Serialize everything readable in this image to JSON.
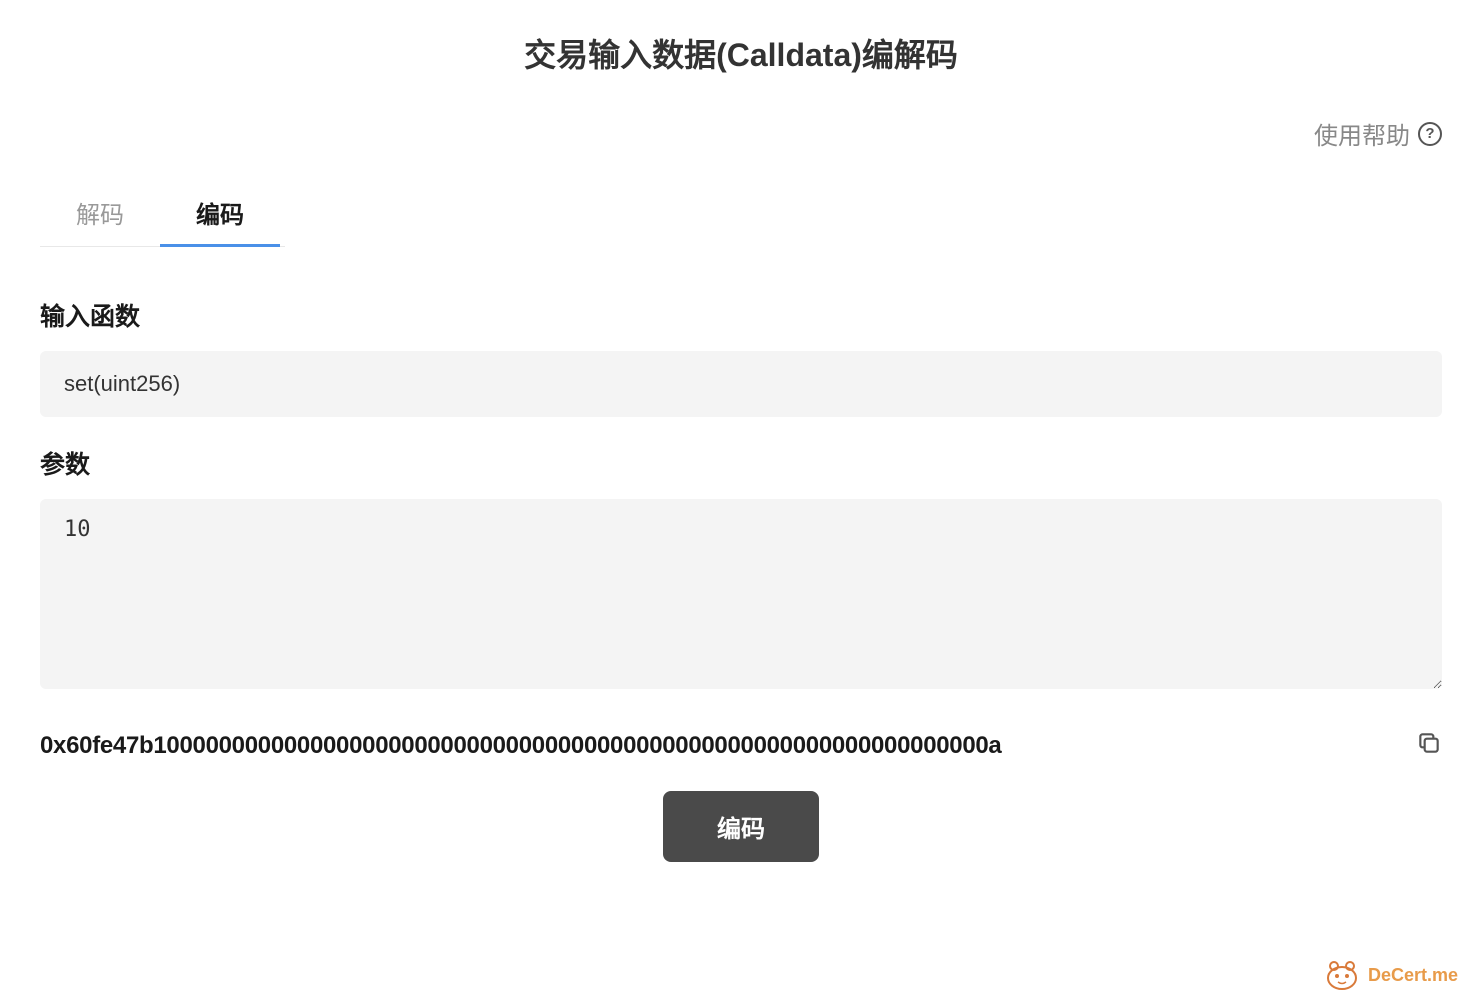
{
  "page_title": "交易输入数据(Calldata)编解码",
  "help": {
    "label": "使用帮助"
  },
  "tabs": [
    {
      "label": "解码",
      "active": false
    },
    {
      "label": "编码",
      "active": true
    }
  ],
  "fields": {
    "function": {
      "label": "输入函数",
      "value": "set(uint256)"
    },
    "params": {
      "label": "参数",
      "value": "10"
    }
  },
  "result": {
    "value": "0x60fe47b1000000000000000000000000000000000000000000000000000000000000000a"
  },
  "buttons": {
    "encode": "编码"
  },
  "brand": {
    "name": "DeCert.me"
  }
}
